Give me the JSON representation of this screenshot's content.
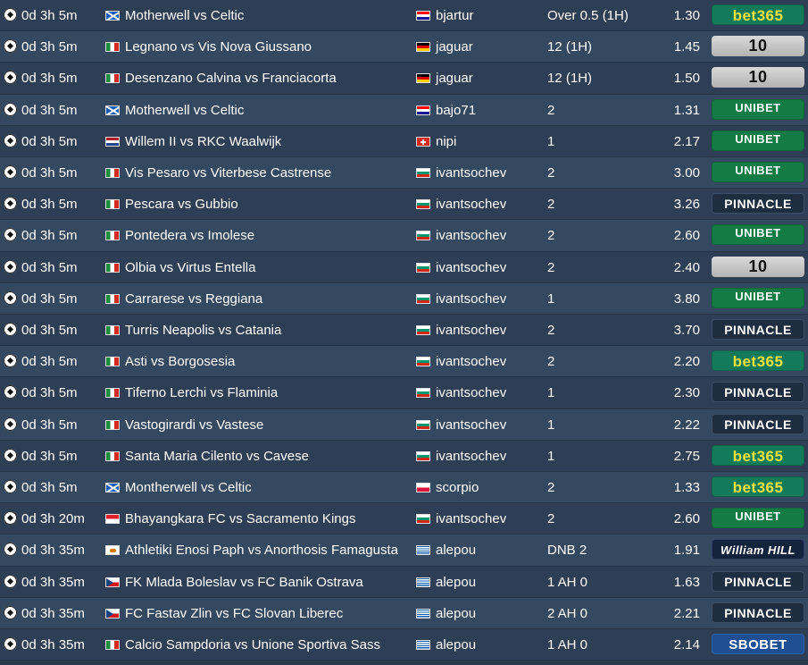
{
  "rows": [
    {
      "time": "0d 3h 5m",
      "flag": "scotland",
      "match": "Motherwell vs Celtic",
      "user_flag": "croatia",
      "user": "bjartur",
      "pick": "Over 0.5 (1H)",
      "odds": "1.30",
      "book": "bet365"
    },
    {
      "time": "0d 3h 5m",
      "flag": "italy",
      "match": "Legnano vs Vis Nova Giussano",
      "user_flag": "germany",
      "user": "jaguar",
      "pick": "12 (1H)",
      "odds": "1.45",
      "book": "10bet"
    },
    {
      "time": "0d 3h 5m",
      "flag": "italy",
      "match": "Desenzano Calvina vs Franciacorta",
      "user_flag": "germany",
      "user": "jaguar",
      "pick": "12 (1H)",
      "odds": "1.50",
      "book": "10bet"
    },
    {
      "time": "0d 3h 5m",
      "flag": "scotland",
      "match": "Motherwell vs Celtic",
      "user_flag": "croatia",
      "user": "bajo71",
      "pick": "2",
      "odds": "1.31",
      "book": "unibet"
    },
    {
      "time": "0d 3h 5m",
      "flag": "netherlands",
      "match": "Willem II vs RKC Waalwijk",
      "user_flag": "switzerland",
      "user": "nipi",
      "pick": "1",
      "odds": "2.17",
      "book": "unibet"
    },
    {
      "time": "0d 3h 5m",
      "flag": "italy",
      "match": "Vis Pesaro vs Viterbese Castrense",
      "user_flag": "bulgaria",
      "user": "ivantsochev",
      "pick": "2",
      "odds": "3.00",
      "book": "unibet"
    },
    {
      "time": "0d 3h 5m",
      "flag": "italy",
      "match": "Pescara vs Gubbio",
      "user_flag": "bulgaria",
      "user": "ivantsochev",
      "pick": "2",
      "odds": "3.26",
      "book": "pinnacle"
    },
    {
      "time": "0d 3h 5m",
      "flag": "italy",
      "match": "Pontedera vs Imolese",
      "user_flag": "bulgaria",
      "user": "ivantsochev",
      "pick": "2",
      "odds": "2.60",
      "book": "unibet"
    },
    {
      "time": "0d 3h 5m",
      "flag": "italy",
      "match": "Olbia vs Virtus Entella",
      "user_flag": "bulgaria",
      "user": "ivantsochev",
      "pick": "2",
      "odds": "2.40",
      "book": "10bet"
    },
    {
      "time": "0d 3h 5m",
      "flag": "italy",
      "match": "Carrarese vs Reggiana",
      "user_flag": "bulgaria",
      "user": "ivantsochev",
      "pick": "1",
      "odds": "3.80",
      "book": "unibet"
    },
    {
      "time": "0d 3h 5m",
      "flag": "italy",
      "match": "Turris Neapolis vs Catania",
      "user_flag": "bulgaria",
      "user": "ivantsochev",
      "pick": "2",
      "odds": "3.70",
      "book": "pinnacle"
    },
    {
      "time": "0d 3h 5m",
      "flag": "italy",
      "match": "Asti vs Borgosesia",
      "user_flag": "bulgaria",
      "user": "ivantsochev",
      "pick": "2",
      "odds": "2.20",
      "book": "bet365"
    },
    {
      "time": "0d 3h 5m",
      "flag": "italy",
      "match": "Tiferno Lerchi vs Flaminia",
      "user_flag": "bulgaria",
      "user": "ivantsochev",
      "pick": "1",
      "odds": "2.30",
      "book": "pinnacle"
    },
    {
      "time": "0d 3h 5m",
      "flag": "italy",
      "match": "Vastogirardi vs Vastese",
      "user_flag": "bulgaria",
      "user": "ivantsochev",
      "pick": "1",
      "odds": "2.22",
      "book": "pinnacle"
    },
    {
      "time": "0d 3h 5m",
      "flag": "italy",
      "match": "Santa Maria Cilento vs Cavese",
      "user_flag": "bulgaria",
      "user": "ivantsochev",
      "pick": "1",
      "odds": "2.75",
      "book": "bet365"
    },
    {
      "time": "0d 3h 5m",
      "flag": "scotland",
      "match": "Montherwell vs Celtic",
      "user_flag": "poland",
      "user": "scorpio",
      "pick": "2",
      "odds": "1.33",
      "book": "bet365"
    },
    {
      "time": "0d 3h 20m",
      "flag": "indonesia",
      "match": "Bhayangkara FC vs Sacramento Kings",
      "user_flag": "bulgaria",
      "user": "ivantsochev",
      "pick": "2",
      "odds": "2.60",
      "book": "unibet"
    },
    {
      "time": "0d 3h 35m",
      "flag": "cyprus",
      "match": "Athletiki Enosi Paph vs Anorthosis Famagusta",
      "user_flag": "greece",
      "user": "alepou",
      "pick": "DNB 2",
      "odds": "1.91",
      "book": "williamhill"
    },
    {
      "time": "0d 3h 35m",
      "flag": "czech",
      "match": "FK Mlada Boleslav vs FC Banik Ostrava",
      "user_flag": "greece",
      "user": "alepou",
      "pick": "1 AH 0",
      "odds": "1.63",
      "book": "pinnacle"
    },
    {
      "time": "0d 3h 35m",
      "flag": "czech",
      "match": "FC Fastav Zlin vs FC Slovan Liberec",
      "user_flag": "greece",
      "user": "alepou",
      "pick": "2 AH 0",
      "odds": "2.21",
      "book": "pinnacle"
    },
    {
      "time": "0d 3h 35m",
      "flag": "italy",
      "match": "Calcio Sampdoria vs Unione Sportiva Sass",
      "user_flag": "greece",
      "user": "alepou",
      "pick": "1 AH 0",
      "odds": "2.14",
      "book": "sbobet"
    }
  ],
  "book_labels": {
    "bet365": "bet365",
    "10bet": "10",
    "unibet": "UNIBET",
    "pinnacle": "PINNACLE",
    "williamhill": "William HILL",
    "sbobet": "SBOBET"
  }
}
